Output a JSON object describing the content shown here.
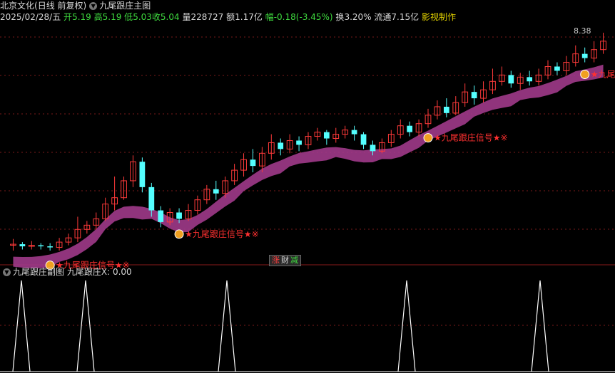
{
  "main_header": {
    "stock_name": "北京文化",
    "period": "(日线 前复权)",
    "indicator": "九尾跟庄主图",
    "date": "2025/02/28/五",
    "open_label": "开",
    "open": "5.19",
    "high_label": "高",
    "high": "5.19",
    "low_label": "低",
    "low": "5.03",
    "close_label": "收",
    "close": "5.04",
    "volume_label": "量",
    "volume": "228727",
    "amount_label": "额",
    "amount": "1.17亿",
    "change_label": "幅",
    "change": "-0.18(-3.45%)",
    "turnover_label": "换",
    "turnover": "3.20%",
    "float_label": "流通",
    "float": "7.15亿",
    "credit": "影视制作"
  },
  "annotations": {
    "high_price": "8.38",
    "signal_text": "★九尾跟庄信号★※",
    "rise_fall_button": [
      "涨",
      "财",
      "减"
    ]
  },
  "sub_header": {
    "indicator": "九尾跟庄副图",
    "series_label": "九尾跟庄X",
    "series_value": "0.00"
  },
  "colors": {
    "up": "#ff3a3a",
    "down": "#54ffff",
    "limit_up": "#ffd800",
    "ribbon_up": "#a03a8a",
    "ribbon_down": "#0c7a1c",
    "signal": "#ff3030",
    "spike": "#ffffff",
    "grid": "#7a1a1a"
  },
  "chart_data": [
    {
      "type": "candlestick",
      "title": "九尾跟庄主图",
      "signals_at_candle_index": [
        4,
        18,
        45,
        62
      ],
      "signal_text": "★九尾跟庄信号★※",
      "candles": [
        [
          0.05,
          0.06,
          0.0,
          0.11
        ],
        [
          0.06,
          0.04,
          0.01,
          0.08
        ],
        [
          0.04,
          0.05,
          0.01,
          0.09
        ],
        [
          0.05,
          0.04,
          0.01,
          0.07
        ],
        [
          0.04,
          0.03,
          0.0,
          0.07
        ],
        [
          0.03,
          0.08,
          0.0,
          0.12
        ],
        [
          0.08,
          0.12,
          0.05,
          0.16
        ],
        [
          0.12,
          0.2,
          0.08,
          0.32
        ],
        [
          0.2,
          0.24,
          0.16,
          0.28
        ],
        [
          0.24,
          0.3,
          0.2,
          0.36
        ],
        [
          0.3,
          0.44,
          0.28,
          0.5
        ],
        [
          0.44,
          0.5,
          0.38,
          0.7
        ],
        [
          0.5,
          0.66,
          0.48,
          0.7
        ],
        [
          0.66,
          0.84,
          0.6,
          0.9
        ],
        [
          0.84,
          0.6,
          0.55,
          0.88
        ],
        [
          0.6,
          0.38,
          0.32,
          0.64
        ],
        [
          0.38,
          0.27,
          0.22,
          0.42
        ],
        [
          0.27,
          0.36,
          0.24,
          0.4
        ],
        [
          0.36,
          0.3,
          0.26,
          0.4
        ],
        [
          0.3,
          0.38,
          0.28,
          0.44
        ],
        [
          0.38,
          0.48,
          0.34,
          0.52
        ],
        [
          0.48,
          0.58,
          0.44,
          0.62
        ],
        [
          0.58,
          0.54,
          0.48,
          0.66
        ],
        [
          0.54,
          0.66,
          0.5,
          0.7
        ],
        [
          0.66,
          0.76,
          0.62,
          0.82
        ],
        [
          0.76,
          0.86,
          0.7,
          0.92
        ],
        [
          0.86,
          0.8,
          0.74,
          0.96
        ],
        [
          0.8,
          0.92,
          0.74,
          0.98
        ],
        [
          0.92,
          1.02,
          0.86,
          1.1
        ],
        [
          1.02,
          0.96,
          0.9,
          1.06
        ],
        [
          0.96,
          1.04,
          0.92,
          1.1
        ],
        [
          1.04,
          1.0,
          0.94,
          1.08
        ],
        [
          1.0,
          1.08,
          0.96,
          1.12
        ],
        [
          1.08,
          1.12,
          1.04,
          1.16
        ],
        [
          1.12,
          1.06,
          1.0,
          1.14
        ],
        [
          1.06,
          1.1,
          1.02,
          1.16
        ],
        [
          1.1,
          1.14,
          1.06,
          1.18
        ],
        [
          1.14,
          1.1,
          1.04,
          1.18
        ],
        [
          1.1,
          1.0,
          0.96,
          1.12
        ],
        [
          1.0,
          0.94,
          0.9,
          1.04
        ],
        [
          0.94,
          1.02,
          0.92,
          1.06
        ],
        [
          1.02,
          1.1,
          0.98,
          1.14
        ],
        [
          1.1,
          1.18,
          1.06,
          1.24
        ],
        [
          1.18,
          1.12,
          1.08,
          1.22
        ],
        [
          1.12,
          1.2,
          1.08,
          1.24
        ],
        [
          1.2,
          1.28,
          1.16,
          1.34
        ],
        [
          1.28,
          1.36,
          1.24,
          1.42
        ],
        [
          1.36,
          1.3,
          1.26,
          1.44
        ],
        [
          1.3,
          1.4,
          1.28,
          1.46
        ],
        [
          1.4,
          1.5,
          1.36,
          1.58
        ],
        [
          1.5,
          1.44,
          1.38,
          1.56
        ],
        [
          1.44,
          1.52,
          1.4,
          1.6
        ],
        [
          1.52,
          1.6,
          1.48,
          1.72
        ],
        [
          1.6,
          1.66,
          1.56,
          1.74
        ],
        [
          1.66,
          1.58,
          1.54,
          1.7
        ],
        [
          1.58,
          1.64,
          1.52,
          1.68
        ],
        [
          1.64,
          1.6,
          1.56,
          1.7
        ],
        [
          1.6,
          1.66,
          1.56,
          1.72
        ],
        [
          1.66,
          1.74,
          1.62,
          1.8
        ],
        [
          1.74,
          1.7,
          1.66,
          1.78
        ],
        [
          1.7,
          1.78,
          1.66,
          1.84
        ],
        [
          1.78,
          1.86,
          1.74,
          1.94
        ],
        [
          1.86,
          1.82,
          1.78,
          1.92
        ],
        [
          1.82,
          1.9,
          1.78,
          1.98
        ],
        [
          1.9,
          1.98,
          1.86,
          2.06
        ]
      ]
    },
    {
      "type": "line",
      "title": "九尾跟庄副图",
      "series": [
        {
          "name": "九尾跟庄X",
          "value": 0.0
        }
      ],
      "spike_x": [
        30,
        120,
        318,
        570,
        757
      ]
    }
  ]
}
